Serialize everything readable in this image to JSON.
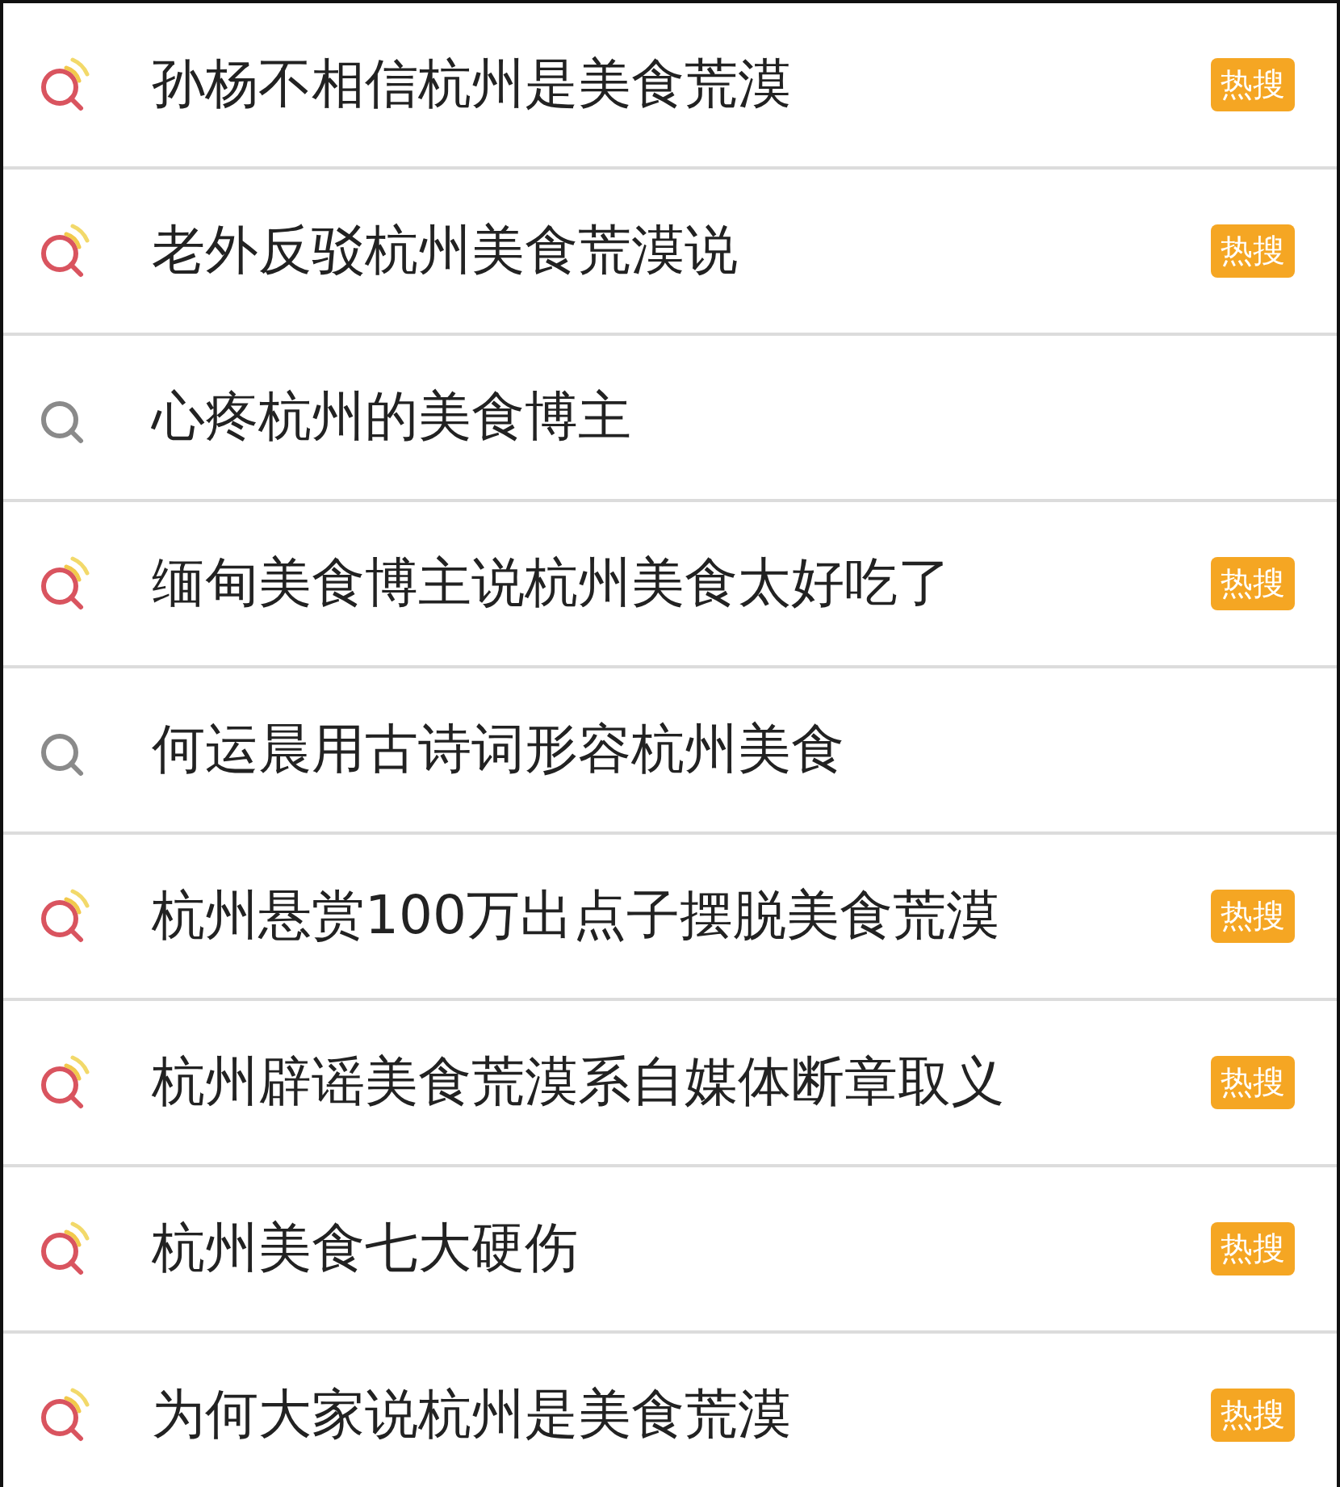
{
  "items": [
    {
      "title": "孙杨不相信杭州是美食荒漠",
      "hot": true,
      "badge": "热搜"
    },
    {
      "title": "老外反驳杭州美食荒漠说",
      "hot": true,
      "badge": "热搜"
    },
    {
      "title": "心疼杭州的美食博主",
      "hot": false
    },
    {
      "title": "缅甸美食博主说杭州美食太好吃了",
      "hot": true,
      "badge": "热搜"
    },
    {
      "title": "何运晨用古诗词形容杭州美食",
      "hot": false
    },
    {
      "title": "杭州悬赏100万出点子摆脱美食荒漠",
      "hot": true,
      "badge": "热搜"
    },
    {
      "title": "杭州辟谣美食荒漠系自媒体断章取义",
      "hot": true,
      "badge": "热搜"
    },
    {
      "title": "杭州美食七大硬伤",
      "hot": true,
      "badge": "热搜"
    },
    {
      "title": "为何大家说杭州是美食荒漠",
      "hot": true,
      "badge": "热搜"
    }
  ]
}
